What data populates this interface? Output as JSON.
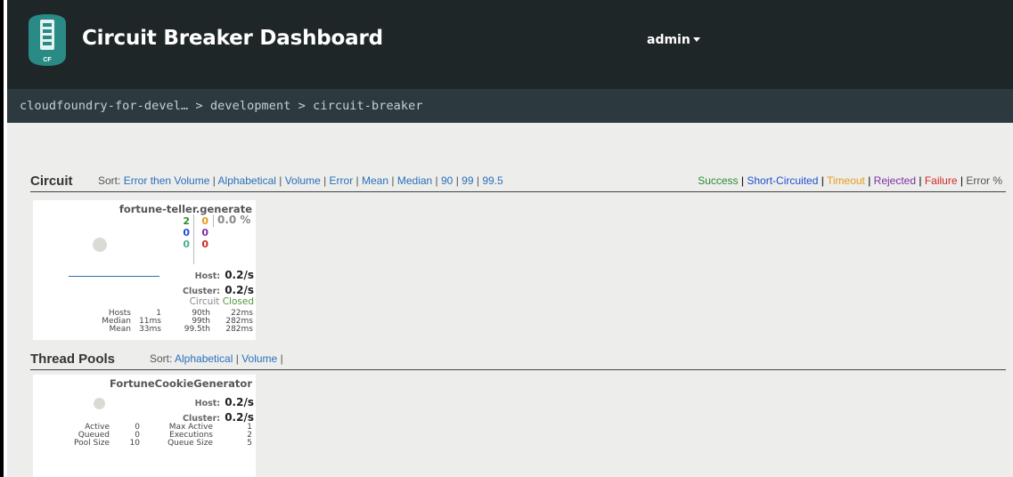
{
  "header": {
    "title": "Circuit Breaker Dashboard",
    "logo_text": "CF",
    "user": "admin"
  },
  "breadcrumb": {
    "org": "cloudfoundry-for-devel…",
    "space": "development",
    "service": "circuit-breaker",
    "separator": ">"
  },
  "circuit_section": {
    "title": "Circuit",
    "sort_label": "Sort:",
    "sort_options": [
      "Error then Volume",
      "Alphabetical",
      "Volume",
      "Error",
      "Mean",
      "Median",
      "90",
      "99",
      "99.5"
    ],
    "legend": [
      {
        "label": "Success",
        "color": "#2e8b2e"
      },
      {
        "label": "Short-Circuited",
        "color": "#1f4fd1"
      },
      {
        "label": "Timeout",
        "color": "#e89a1a"
      },
      {
        "label": "Rejected",
        "color": "#7b2fa0"
      },
      {
        "label": "Failure",
        "color": "#d42626"
      },
      {
        "label": "Error %",
        "color": "#555555"
      }
    ]
  },
  "circuit_card": {
    "name": "fortune-teller.generate",
    "counts": {
      "success": "2",
      "timeout": "0",
      "short_circuited": "0",
      "rejected": "0",
      "bad_request": "0",
      "failure": "0"
    },
    "error_pct": "0.0 %",
    "host_label": "Host:",
    "host_rate": "0.2/s",
    "cluster_label": "Cluster:",
    "cluster_rate": "0.2/s",
    "circuit_label": "Circuit",
    "circuit_state": "Closed",
    "stats": {
      "hosts_label": "Hosts",
      "hosts": "1",
      "median_label": "Median",
      "median": "11ms",
      "mean_label": "Mean",
      "mean": "33ms",
      "p90_label": "90th",
      "p90": "22ms",
      "p99_label": "99th",
      "p99": "282ms",
      "p995_label": "99.5th",
      "p995": "282ms"
    }
  },
  "thread_section": {
    "title": "Thread Pools",
    "sort_label": "Sort:",
    "sort_options": [
      "Alphabetical",
      "Volume"
    ]
  },
  "thread_card": {
    "name": "FortuneCookieGenerator",
    "host_label": "Host:",
    "host_rate": "0.2/s",
    "cluster_label": "Cluster:",
    "cluster_rate": "0.2/s",
    "stats": {
      "active_label": "Active",
      "active": "0",
      "queued_label": "Queued",
      "queued": "0",
      "pool_size_label": "Pool Size",
      "pool_size": "10",
      "max_active_label": "Max Active",
      "max_active": "1",
      "executions_label": "Executions",
      "executions": "2",
      "queue_size_label": "Queue Size",
      "queue_size": "5"
    }
  }
}
